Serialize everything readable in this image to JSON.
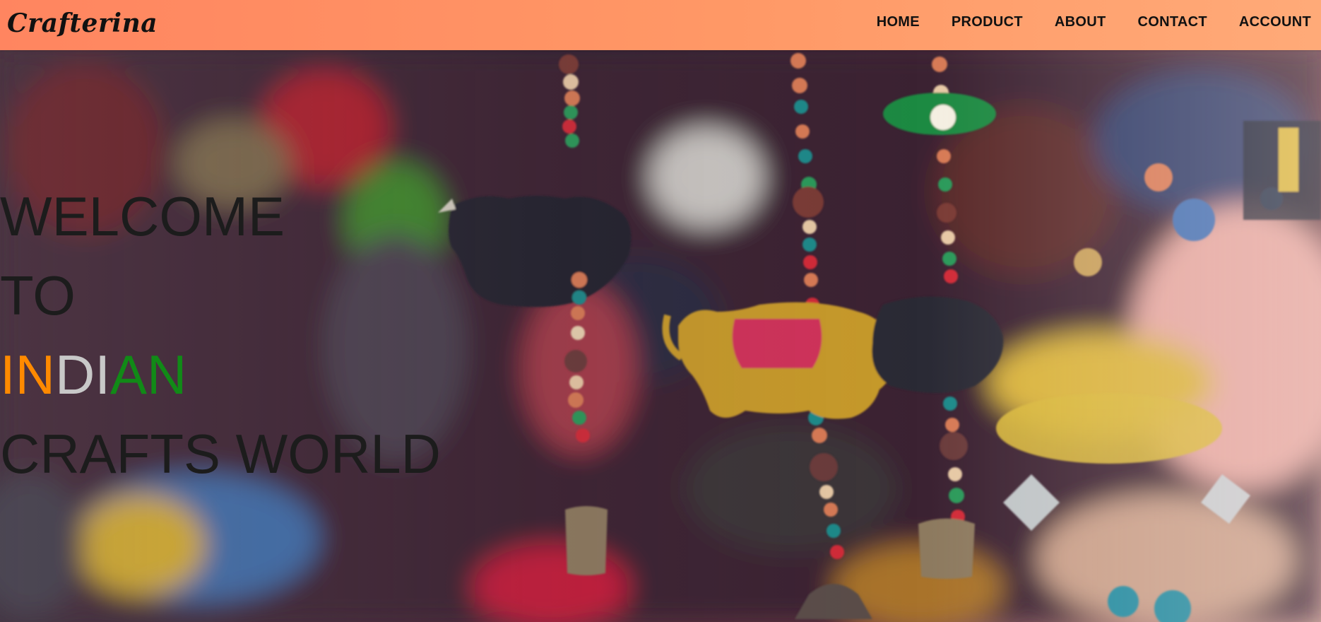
{
  "header": {
    "logo": "Crafterina",
    "nav": [
      {
        "label": "HOME"
      },
      {
        "label": "PRODUCT"
      },
      {
        "label": "ABOUT"
      },
      {
        "label": "CONTACT"
      },
      {
        "label": "ACCOUNT"
      }
    ]
  },
  "hero": {
    "line1": "WELCOME",
    "line2": "TO",
    "line3_parts": [
      "IN",
      "DI",
      "AN"
    ],
    "line4": "CRAFTS WORLD",
    "image_description": "hanging-craft-ornaments-image"
  },
  "colors": {
    "nav_bg": "#ff8a62",
    "saffron": "#ff8a00",
    "white": "#c8c8c8",
    "green": "#118a17",
    "text": "#1c1c1c"
  }
}
